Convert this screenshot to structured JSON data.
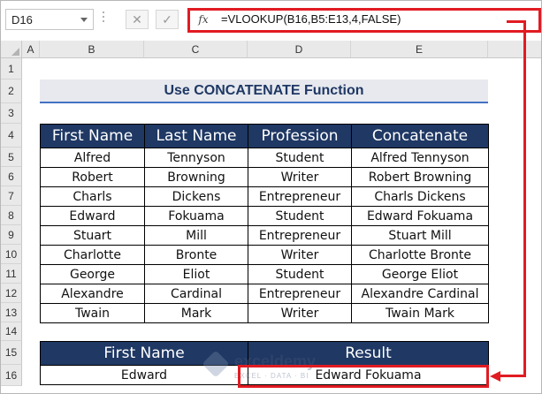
{
  "formula_bar": {
    "name_box": "D16",
    "cancel_icon": "✕",
    "enter_icon": "✓",
    "fx_label": "fx",
    "formula": "=VLOOKUP(B16,B5:E13,4,FALSE)"
  },
  "columns": [
    "A",
    "B",
    "C",
    "D",
    "E"
  ],
  "rows": [
    "1",
    "2",
    "3",
    "4",
    "5",
    "6",
    "7",
    "8",
    "9",
    "10",
    "11",
    "12",
    "13",
    "14",
    "15",
    "16"
  ],
  "title": "Use CONCATENATE Function",
  "table": {
    "headers": [
      "First Name",
      "Last Name",
      "Profession",
      "Concatenate"
    ],
    "rows": [
      [
        "Alfred",
        "Tennyson",
        "Student",
        "Alfred Tennyson"
      ],
      [
        "Robert",
        "Browning",
        "Writer",
        "Robert Browning"
      ],
      [
        "Charls",
        "Dickens",
        "Entrepreneur",
        "Charls Dickens"
      ],
      [
        "Edward",
        "Fokuama",
        "Student",
        "Edward Fokuama"
      ],
      [
        "Stuart",
        "Mill",
        "Entrepreneur",
        "Stuart Mill"
      ],
      [
        "Charlotte",
        "Bronte",
        "Writer",
        "Charlotte Bronte"
      ],
      [
        "George",
        "Eliot",
        "Student",
        "George Eliot"
      ],
      [
        "Alexandre",
        "Cardinal",
        "Entrepreneur",
        "Alexandre Cardinal"
      ],
      [
        "Twain",
        "Mark",
        "Writer",
        "Twain Mark"
      ]
    ]
  },
  "lookup": {
    "headers": [
      "First Name",
      "Result"
    ],
    "input": "Edward",
    "result": "Edward Fokuama"
  },
  "watermark": {
    "name": "exceldemy",
    "tagline": "EXCEL · DATA · BI"
  },
  "colors": {
    "header_bg": "#1f3864",
    "title_bg": "#e7e9ee",
    "accent_line": "#4472c4",
    "highlight": "#e11b22"
  }
}
